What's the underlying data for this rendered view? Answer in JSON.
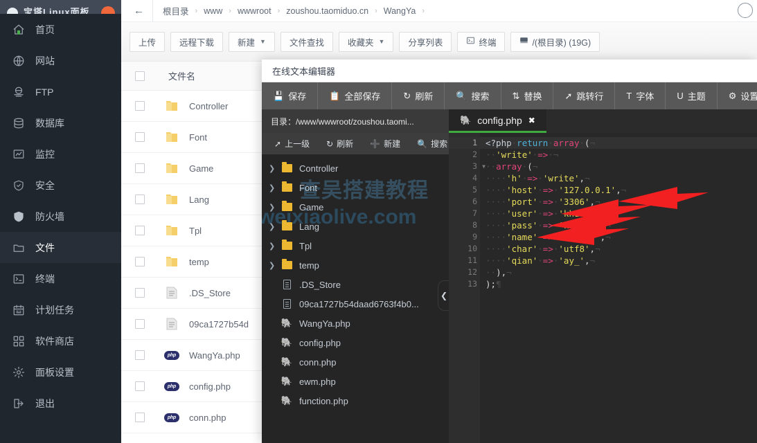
{
  "sidebar": {
    "logo_text": "宝塔Linux面板",
    "items": [
      {
        "label": "首页",
        "icon": "home-icon",
        "active": false
      },
      {
        "label": "网站",
        "icon": "globe-icon",
        "active": false
      },
      {
        "label": "FTP",
        "icon": "ftp-icon",
        "active": false
      },
      {
        "label": "数据库",
        "icon": "database-icon",
        "active": false
      },
      {
        "label": "监控",
        "icon": "monitor-icon",
        "active": false
      },
      {
        "label": "安全",
        "icon": "shield-check-icon",
        "active": false
      },
      {
        "label": "防火墙",
        "icon": "firewall-icon",
        "active": false
      },
      {
        "label": "文件",
        "icon": "folder-icon",
        "active": true
      },
      {
        "label": "终端",
        "icon": "terminal-icon",
        "active": false
      },
      {
        "label": "计划任务",
        "icon": "calendar-icon",
        "active": false
      },
      {
        "label": "软件商店",
        "icon": "apps-icon",
        "active": false
      },
      {
        "label": "面板设置",
        "icon": "gear-icon",
        "active": false
      },
      {
        "label": "退出",
        "icon": "logout-icon",
        "active": false
      }
    ]
  },
  "breadcrumb": {
    "back_icon": "arrow-left-icon",
    "segments": [
      "根目录",
      "www",
      "wwwroot",
      "zoushou.taomiduo.cn",
      "WangYa"
    ],
    "separator": "›"
  },
  "toolbar": {
    "buttons": [
      {
        "label": "上传",
        "caret": false,
        "icon": null
      },
      {
        "label": "远程下载",
        "caret": false,
        "icon": null
      },
      {
        "label": "新建",
        "caret": true,
        "icon": null
      },
      {
        "label": "文件查找",
        "caret": false,
        "icon": null
      },
      {
        "label": "收藏夹",
        "caret": true,
        "icon": null
      },
      {
        "label": "分享列表",
        "caret": false,
        "icon": null
      },
      {
        "label": "终端",
        "caret": false,
        "icon": "terminal-icon"
      },
      {
        "label": "/(根目录) (19G)",
        "caret": false,
        "icon": "disk-icon"
      }
    ]
  },
  "filelist": {
    "header": "文件名",
    "rows": [
      {
        "name": "Controller",
        "type": "folder"
      },
      {
        "name": "Font",
        "type": "folder"
      },
      {
        "name": "Game",
        "type": "folder"
      },
      {
        "name": "Lang",
        "type": "folder"
      },
      {
        "name": "Tpl",
        "type": "folder"
      },
      {
        "name": "temp",
        "type": "folder"
      },
      {
        "name": ".DS_Store",
        "type": "doc"
      },
      {
        "name": "09ca1727b54d",
        "type": "doc"
      },
      {
        "name": "WangYa.php",
        "type": "php"
      },
      {
        "name": "config.php",
        "type": "php"
      },
      {
        "name": "conn.php",
        "type": "php"
      }
    ]
  },
  "editor": {
    "title": "在线文本编辑器",
    "toolbar": [
      {
        "label": "保存",
        "icon": "save-icon"
      },
      {
        "label": "全部保存",
        "icon": "save-all-icon"
      },
      {
        "label": "刷新",
        "icon": "refresh-icon"
      },
      {
        "label": "搜索",
        "icon": "search-icon"
      },
      {
        "label": "替换",
        "icon": "replace-icon"
      },
      {
        "label": "跳转行",
        "icon": "goto-line-icon"
      },
      {
        "label": "字体",
        "icon": "font-icon"
      },
      {
        "label": "主题",
        "icon": "theme-icon"
      },
      {
        "label": "设置",
        "icon": "gear-icon"
      }
    ],
    "path_label": "目录：/www/wwwroot/zoushou.taomi...",
    "tab": {
      "name": "config.php",
      "icon": "php-elephant-icon",
      "close": "✖"
    },
    "tree_toolbar": [
      {
        "label": "上一级",
        "icon": "arrow-up-icon"
      },
      {
        "label": "刷新",
        "icon": "refresh-icon"
      },
      {
        "label": "新建",
        "icon": "plus-icon"
      },
      {
        "label": "搜索",
        "icon": "search-icon"
      }
    ],
    "tree": [
      {
        "name": "Controller",
        "type": "folder"
      },
      {
        "name": "Font",
        "type": "folder"
      },
      {
        "name": "Game",
        "type": "folder"
      },
      {
        "name": "Lang",
        "type": "folder"
      },
      {
        "name": "Tpl",
        "type": "folder"
      },
      {
        "name": "temp",
        "type": "folder"
      },
      {
        "name": ".DS_Store",
        "type": "doc"
      },
      {
        "name": "09ca1727b54daad6763f4b0...",
        "type": "doc"
      },
      {
        "name": "WangYa.php",
        "type": "php"
      },
      {
        "name": "config.php",
        "type": "php"
      },
      {
        "name": "conn.php",
        "type": "php"
      },
      {
        "name": "ewm.php",
        "type": "php"
      },
      {
        "name": "function.php",
        "type": "php"
      }
    ],
    "collapse_icon": "chevron-left-icon",
    "watermark_1": "查吴搭建教程",
    "watermark_2": "weixiaolive.com",
    "code_lines": [
      {
        "n": "1",
        "fold": true,
        "hl": true
      },
      {
        "n": "2",
        "fold": false,
        "hl": false
      },
      {
        "n": "3",
        "fold": true,
        "hl": false
      },
      {
        "n": "4",
        "fold": false,
        "hl": false
      },
      {
        "n": "5",
        "fold": false,
        "hl": false
      },
      {
        "n": "6",
        "fold": false,
        "hl": false
      },
      {
        "n": "7",
        "fold": false,
        "hl": false
      },
      {
        "n": "8",
        "fold": false,
        "hl": false
      },
      {
        "n": "9",
        "fold": false,
        "hl": false
      },
      {
        "n": "10",
        "fold": false,
        "hl": false
      },
      {
        "n": "11",
        "fold": false,
        "hl": false
      },
      {
        "n": "12",
        "fold": false,
        "hl": false
      },
      {
        "n": "13",
        "fold": false,
        "hl": false
      }
    ],
    "code_text": [
      "<?php return array (",
      "  'write' => ",
      "  array (",
      "    'h' => 'write',",
      "    'host' => '127.0.0.1',",
      "    'port' => '3306',",
      "    'user' => 'khddcs',",
      "    'pass' => 'khddcs',",
      "    'name' => 'khddcs',",
      "    'char' => 'utf8',",
      "    'qian' => 'ay_',",
      "  ),",
      ");"
    ],
    "config_values": {
      "h": "write",
      "host": "127.0.0.1",
      "port": "3306",
      "user": "khddcs",
      "pass": "khddcs",
      "name": "khddcs",
      "char": "utf8",
      "qian": "ay_"
    },
    "annotation_arrows": 4,
    "annotation_color": "#f22020"
  },
  "colors": {
    "sidebar_bg": "#20262e",
    "sidebar_active": "#272e37",
    "accent_orange": "#f1683c",
    "editor_toolbar": "#585858",
    "tab_underline": "#3faa3f",
    "folder_yellow": "#ecb731",
    "php_badge": "#2b2f6b",
    "string_yellow": "#e6db5a",
    "keyword_blue": "#4fb3d9",
    "function_pink": "#e0457b"
  }
}
